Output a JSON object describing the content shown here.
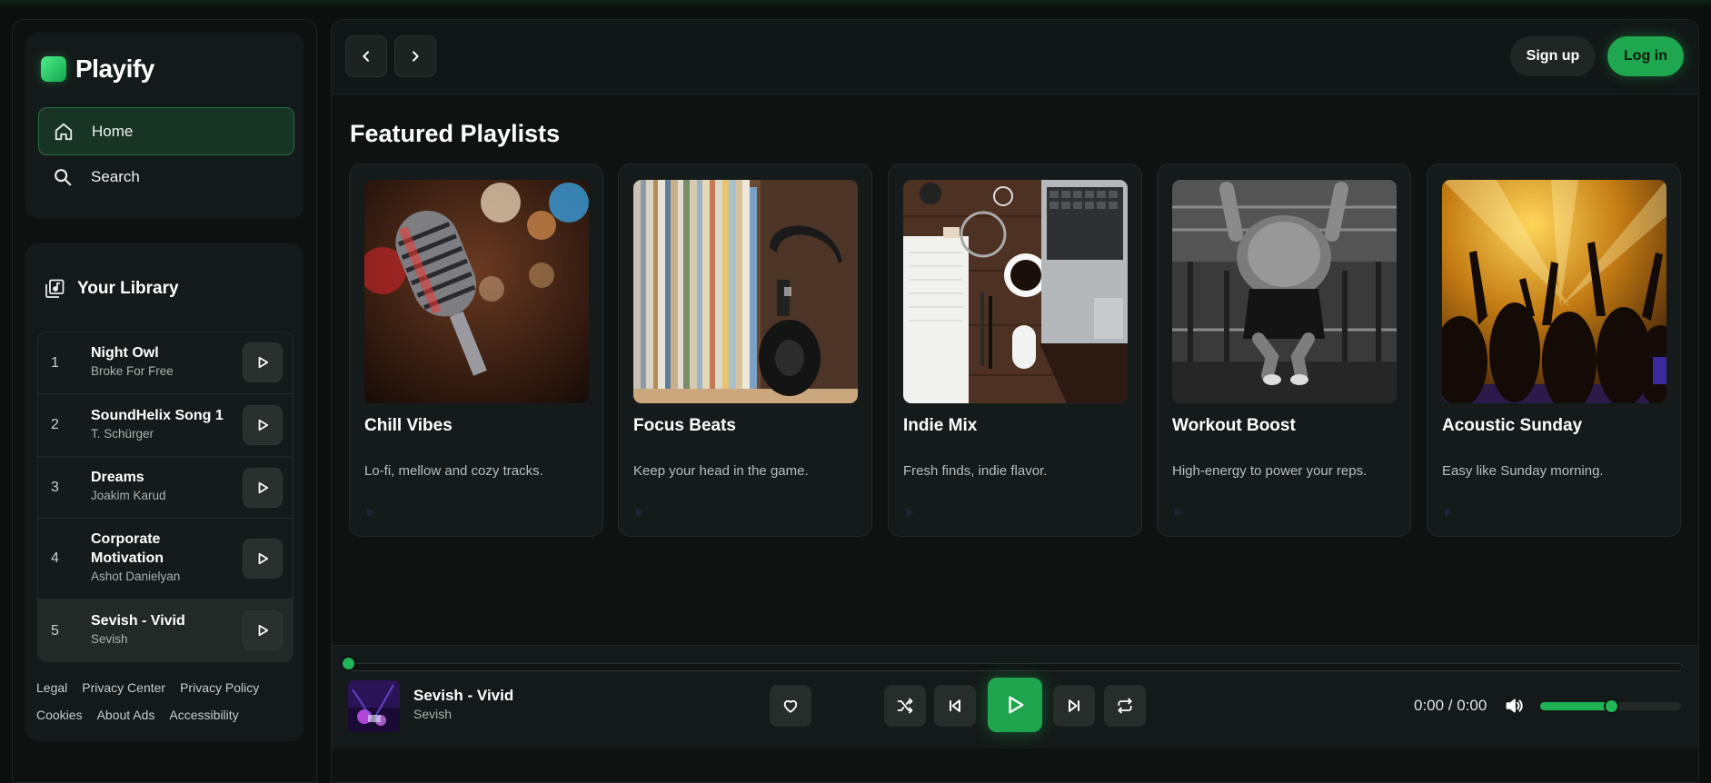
{
  "app": {
    "name": "Playify",
    "accent": "#1fa74f"
  },
  "sidebar": {
    "nav": [
      {
        "label": "Home",
        "icon": "home-icon",
        "active": true
      },
      {
        "label": "Search",
        "icon": "search-icon",
        "active": false
      }
    ],
    "library": {
      "title": "Your Library",
      "tracks": [
        {
          "num": "1",
          "title": "Night Owl",
          "artist": "Broke For Free"
        },
        {
          "num": "2",
          "title": "SoundHelix Song 1",
          "artist": "T. Schürger"
        },
        {
          "num": "3",
          "title": "Dreams",
          "artist": "Joakim Karud"
        },
        {
          "num": "4",
          "title": "Corporate Motivation",
          "artist": "Ashot Danielyan"
        },
        {
          "num": "5",
          "title": "Sevish - Vivid",
          "artist": "Sevish"
        }
      ]
    },
    "footer_links": [
      "Legal",
      "Privacy Center",
      "Privacy Policy",
      "Cookies",
      "About Ads",
      "Accessibility"
    ]
  },
  "header": {
    "back_icon": "chevron-left-icon",
    "forward_icon": "chevron-right-icon",
    "signup_label": "Sign up",
    "login_label": "Log in"
  },
  "main": {
    "section_title": "Featured Playlists",
    "playlists": [
      {
        "title": "Chill Vibes",
        "desc": "Lo-fi, mellow and cozy tracks."
      },
      {
        "title": "Focus Beats",
        "desc": "Keep your head in the game."
      },
      {
        "title": "Indie Mix",
        "desc": "Fresh finds, indie flavor."
      },
      {
        "title": "Workout Boost",
        "desc": "High-energy to power your reps."
      },
      {
        "title": "Acoustic Sunday",
        "desc": "Easy like Sunday morning."
      }
    ]
  },
  "player": {
    "title": "Sevish - Vivid",
    "artist": "Sevish",
    "time": "0:00 / 0:00",
    "progress": 0,
    "volume": 0.5
  }
}
